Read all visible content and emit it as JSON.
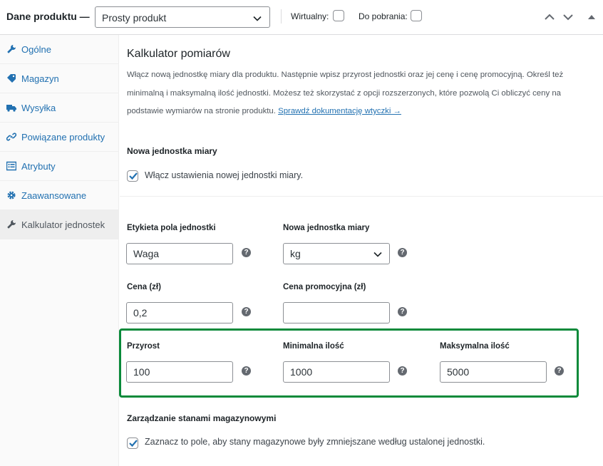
{
  "header": {
    "title": "Dane produktu —",
    "product_type": "Prosty produkt",
    "virtual_label": "Wirtualny:",
    "downloadable_label": "Do pobrania:"
  },
  "sidebar": {
    "items": [
      {
        "label": "Ogólne",
        "icon": "wrench-icon"
      },
      {
        "label": "Magazyn",
        "icon": "tag-icon"
      },
      {
        "label": "Wysyłka",
        "icon": "truck-icon"
      },
      {
        "label": "Powiązane produkty",
        "icon": "link-icon"
      },
      {
        "label": "Atrybuty",
        "icon": "list-icon"
      },
      {
        "label": "Zaawansowane",
        "icon": "gear-icon"
      },
      {
        "label": "Kalkulator jednostek",
        "icon": "wrench-icon"
      }
    ],
    "active_index": 6
  },
  "main": {
    "heading": "Kalkulator pomiarów",
    "description": "Włącz nową jednostkę miary dla produktu. Następnie wpisz przyrost jednostki oraz jej cenę i cenę promocyjną. Określ też minimalną i maksymalną ilość jednostki. Możesz też skorzystać z opcji rozszerzonych, które pozwolą Ci obliczyć ceny na podstawie wymiarów na stronie produktu.",
    "doc_link": "Sprawdź dokumentację wtyczki →",
    "new_unit_section": "Nowa jednostka miary",
    "enable_new_unit": "Włącz ustawienia nowej jednostki miary.",
    "fields": {
      "unit_label_title": "Etykieta pola jednostki",
      "unit_label_value": "Waga",
      "new_unit_title": "Nowa jednostka miary",
      "new_unit_value": "kg",
      "price_title": "Cena (zł)",
      "price_value": "0,2",
      "sale_price_title": "Cena promocyjna (zł)",
      "sale_price_value": "",
      "increment_title": "Przyrost",
      "increment_value": "100",
      "min_title": "Minimalna ilość",
      "min_value": "1000",
      "max_title": "Maksymalna ilość",
      "max_value": "5000"
    },
    "stock_section": "Zarządzanie stanami magazynowymi",
    "stock_checkbox": "Zaznacz to pole, aby stany magazynowe były zmniejszane według ustalonej jednostki.",
    "help_glyph": "?"
  },
  "colors": {
    "highlight": "#0a8a3a",
    "link": "#2271b1",
    "checkbox": "#2271b1"
  }
}
